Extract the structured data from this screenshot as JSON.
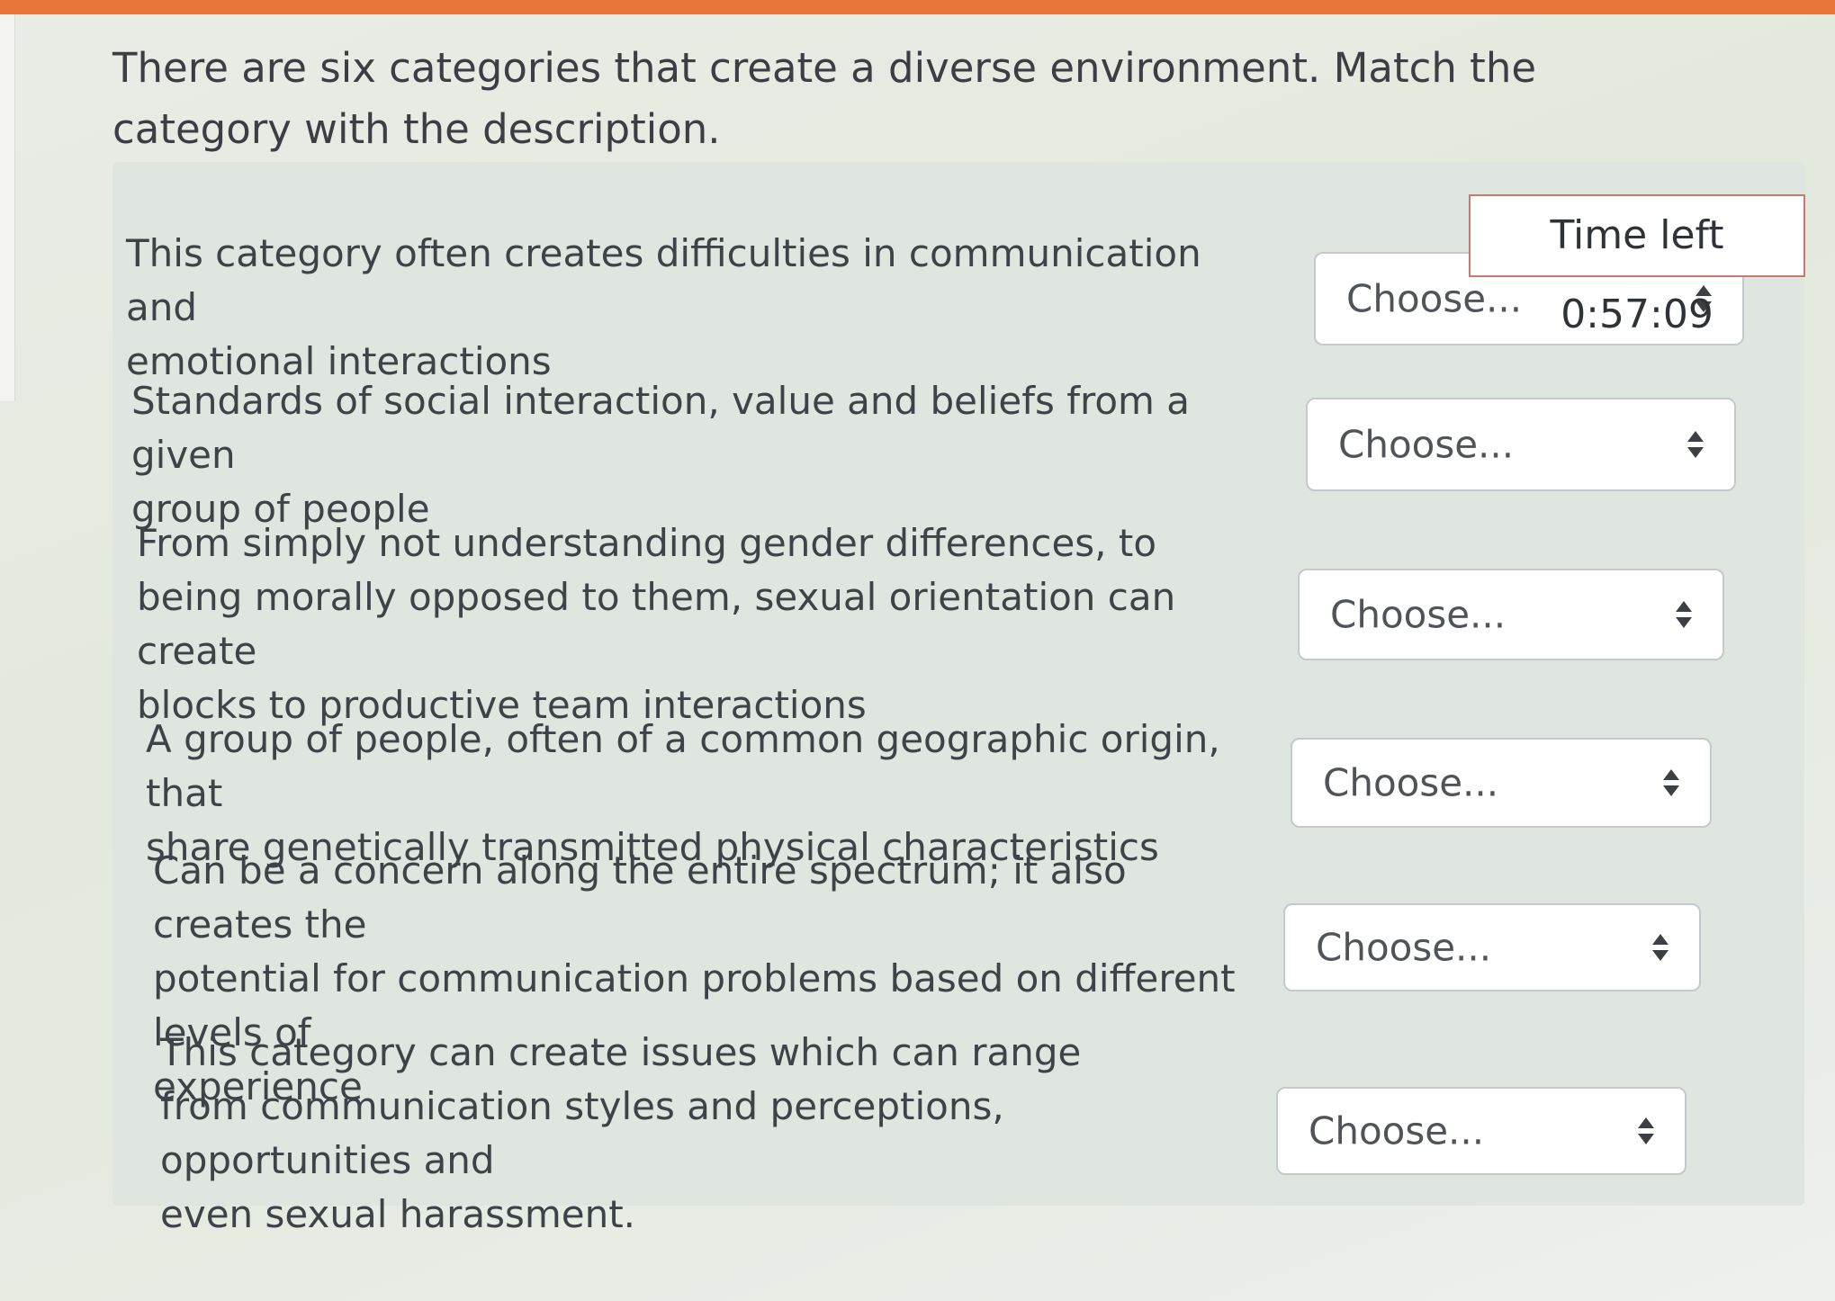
{
  "question": {
    "prompt": "There are six categories that create a diverse environment. Match the category with the description.",
    "timer_label": "Time left 0:57:09"
  },
  "items": [
    {
      "description_lines": [
        "This category often creates difficulties in communication and",
        "emotional interactions"
      ],
      "select_value": "Choose..."
    },
    {
      "description_lines": [
        "Standards of social interaction, value and beliefs from a given",
        "group of people"
      ],
      "select_value": "Choose..."
    },
    {
      "description_lines": [
        "From simply not understanding gender differences, to",
        "being morally opposed to them, sexual orientation can create",
        "blocks to productive team interactions"
      ],
      "select_value": "Choose..."
    },
    {
      "description_lines": [
        "A group of people, often of a common geographic origin, that",
        "share genetically transmitted physical characteristics"
      ],
      "select_value": "Choose..."
    },
    {
      "description_lines": [
        "Can be a concern along the entire spectrum; it also creates the",
        "potential for communication problems based on different levels of",
        "experience"
      ],
      "select_value": "Choose..."
    },
    {
      "description_lines": [
        "This category can create issues which can range",
        "from communication styles and perceptions, opportunities and",
        "even sexual harassment."
      ],
      "select_value": "Choose..."
    }
  ],
  "icons": {
    "select_arrow": "updown-caret-icon"
  },
  "colors": {
    "top_strip": "#e8753a",
    "timer_border": "#c97a6e",
    "panel": "#dfe6e0"
  }
}
